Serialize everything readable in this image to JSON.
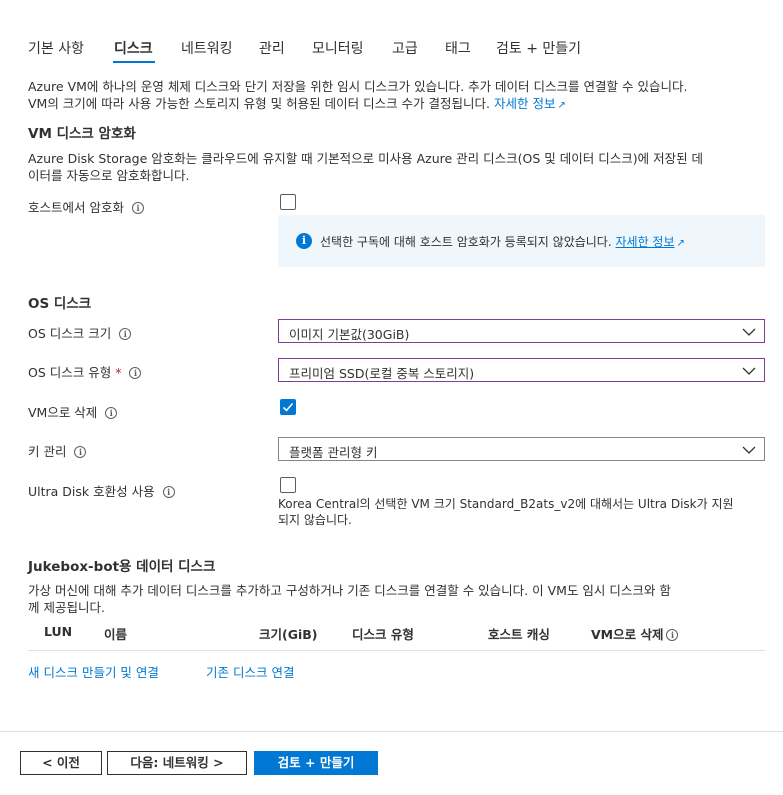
{
  "tabs": [
    {
      "label": "기본 사항"
    },
    {
      "label": "디스크"
    },
    {
      "label": "네트워킹"
    },
    {
      "label": "관리"
    },
    {
      "label": "모니터링"
    },
    {
      "label": "고급"
    },
    {
      "label": "태그"
    },
    {
      "label": "검토 + 만들기"
    }
  ],
  "active_tab": "디스크",
  "intro": {
    "line1": "Azure VM에 하나의 운영 체제 디스크와 단기 저장을 위한 임시 디스크가 있습니다. 추가 데이터 디스크를 연결할 수 있습니다.",
    "line2": "VM의 크기에 따라 사용 가능한 스토리지 유형 및 허용된 데이터 디스크 수가 결정됩니다.",
    "link": "자세한 정보"
  },
  "encryption": {
    "heading": "VM 디스크 암호화",
    "desc_line1": "Azure Disk Storage 암호화는 클라우드에 유지할 때 기본적으로 미사용 Azure 관리 디스크(OS 및 데이터 디스크)에 저장된 데",
    "desc_line2": "이터를 자동으로 암호화합니다.",
    "host_label": "호스트에서 암호화",
    "host_checked": false,
    "info_text": "선택한 구독에 대해 호스트 암호화가 등록되지 않았습니다.",
    "info_link": "자세한 정보"
  },
  "os_disk": {
    "heading": "OS 디스크",
    "size_label": "OS 디스크 크기",
    "size_value": "이미지 기본값(30GiB)",
    "type_label": "OS 디스크 유형",
    "required_mark": "*",
    "type_value": "프리미엄 SSD(로컬 중복 스토리지)",
    "delete_label": "VM으로 삭제",
    "delete_checked": true,
    "key_label": "키 관리",
    "key_value": "플랫폼 관리형 키",
    "ultra_label": "Ultra Disk 호환성 사용",
    "ultra_checked": false,
    "ultra_note_line1": "Korea Central의 선택한 VM 크기 Standard_B2ats_v2에 대해서는 Ultra Disk가 지원",
    "ultra_note_line2": "되지 않습니다."
  },
  "data_disks": {
    "heading": "Jukebox-bot용 데이터 디스크",
    "desc_line1": "가상 머신에 대해 추가 데이터 디스크를 추가하고 구성하거나 기존 디스크를 연결할 수 있습니다. 이 VM도 임시 디스크와 함",
    "desc_line2": "께 제공됩니다.",
    "columns": [
      "LUN",
      "이름",
      "크기(GiB)",
      "디스크 유형",
      "호스트 캐싱",
      "VM으로 삭제"
    ],
    "create_link": "새 디스크 만들기 및 연결",
    "attach_link": "기존 디스크 연결"
  },
  "footer": {
    "prev": "< 이전",
    "next": "다음: 네트워킹 >",
    "review": "검토 + 만들기"
  },
  "colors": {
    "accent": "#0078d4",
    "info_bg": "#eff6fc",
    "required": "#a4262c"
  }
}
